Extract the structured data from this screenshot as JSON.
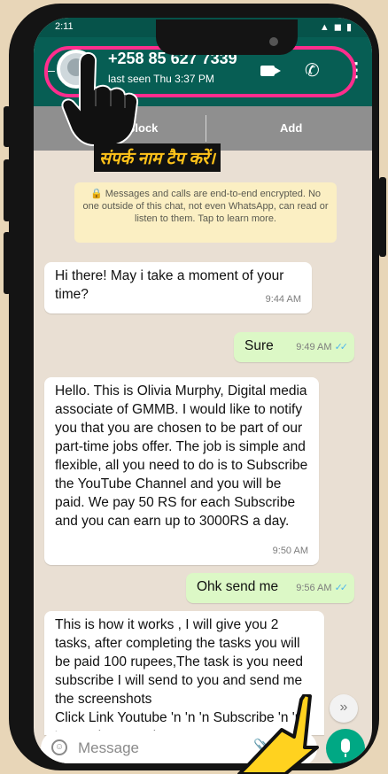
{
  "status": {
    "time": "2:11",
    "icons": "▲ ◼ ▮"
  },
  "header": {
    "back": "←",
    "contact_name": "+258 85 627 7339",
    "last_seen": "last seen Thu 3:37 PM",
    "call_glyph": "✆",
    "more_glyph": "⋮"
  },
  "actionbar": {
    "block_label": "Block",
    "add_label": "Add"
  },
  "annotation": {
    "label": "संपर्क नाम टैप करें।",
    "accent": "#ff2d8d",
    "label_color": "#ffc21a"
  },
  "chat": {
    "encryption_notice": "🔒 Messages and calls are end-to-end encrypted. No one outside of this chat, not even WhatsApp, can read or listen to them. Tap to learn more.",
    "messages": [
      {
        "direction": "in",
        "text": "Hi there! May i take a moment of your time?",
        "time": "9:44 AM"
      },
      {
        "direction": "out",
        "text": "Sure",
        "time": "9:49 AM",
        "read": true
      },
      {
        "direction": "in",
        "text": "Hello. This is Olivia Murphy,  Digital media associate of GMMB. I would like to notify you that you are chosen to be part of our part-time jobs offer. The job is simple and flexible, all you need to do is to Subscribe the YouTube Channel and you will be paid. We pay 50 RS for each Subscribe and you can earn up to 3000RS a day.",
        "time": "9:50 AM"
      },
      {
        "direction": "out",
        "text": "Ohk send me",
        "time": "9:56 AM",
        "read": true
      },
      {
        "direction": "in",
        "text": "This is how it works , I will give you 2 tasks, after completing the tasks you will be paid 100 rupees,The task is you need subscribe I will send to you and send me the screenshots\nClick Link Youtube 'n 'n 'n Subscribe 'n 'n 'n  Send screenshots to me",
        "time": ""
      }
    ],
    "scroll_down_glyph": "»"
  },
  "composer": {
    "placeholder": "Message",
    "emoji_glyph": "☺",
    "attach_glyph": "📎"
  },
  "colors": {
    "header": "#075e54",
    "outgoing": "#dcf8c6",
    "tick": "#4fb6ec",
    "mic": "#00a884"
  }
}
